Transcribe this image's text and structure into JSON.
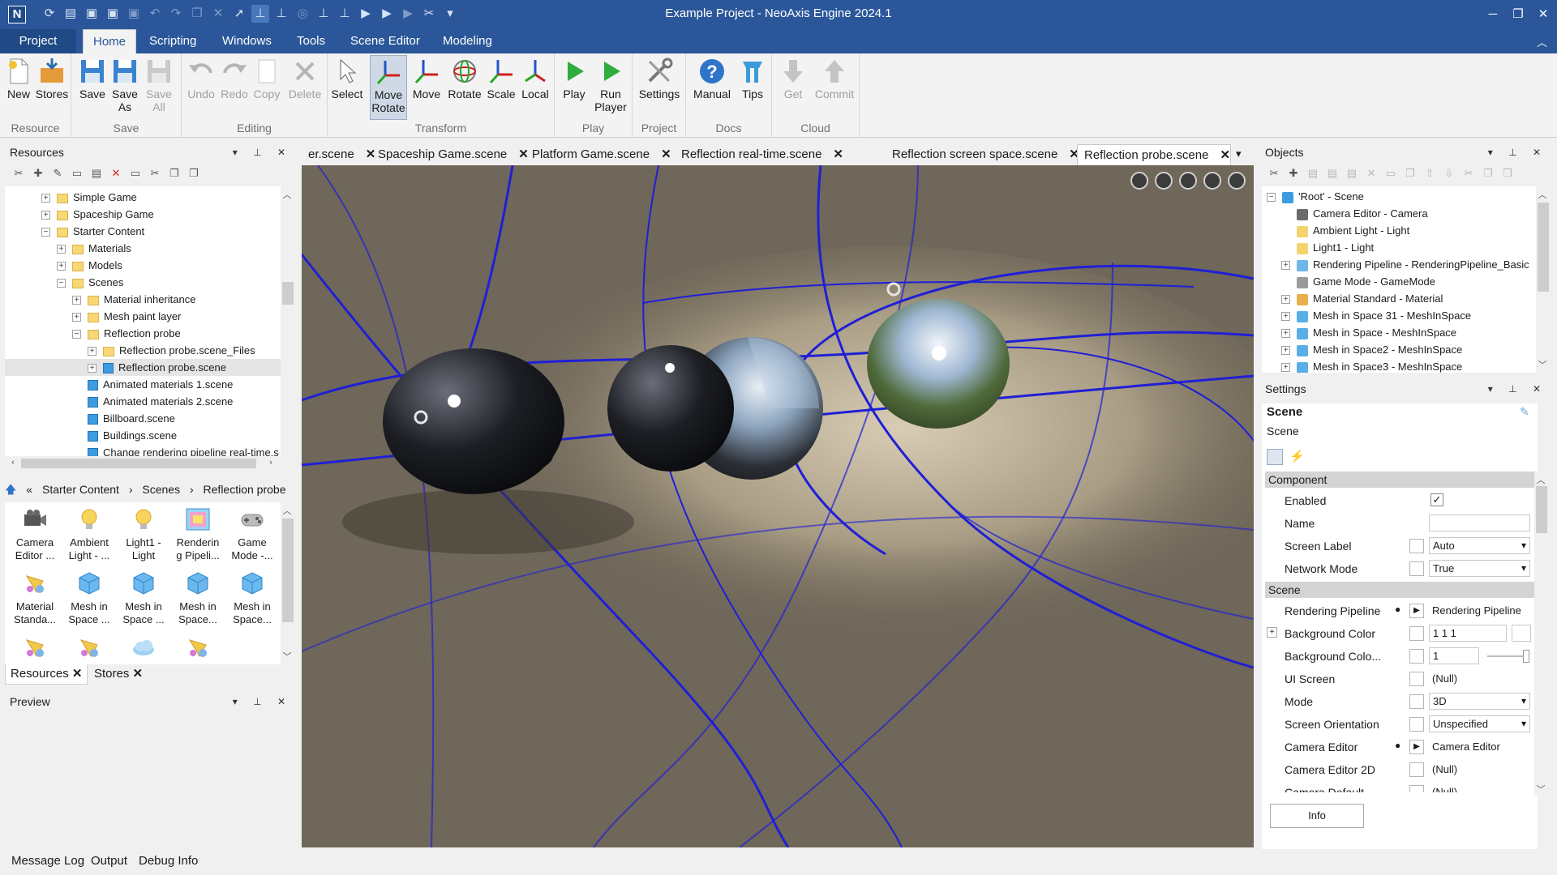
{
  "window": {
    "title": "Example Project - NeoAxis Engine 2024.1",
    "logo": "N"
  },
  "quick_access": [
    "refresh-icon",
    "new-icon",
    "save-icon",
    "save-all-icon",
    "save-as-icon",
    "undo-icon",
    "redo-icon",
    "copy-icon",
    "delete-icon",
    "select-icon",
    "move-rotate-icon",
    "move-icon",
    "rotate-icon",
    "scale-icon",
    "local-icon",
    "play-icon",
    "run-player-icon",
    "settings-icon",
    "dropdown-icon"
  ],
  "ribbon_tabs": [
    "Project",
    "Home",
    "Scripting",
    "Windows",
    "Tools",
    "Scene Editor",
    "Modeling"
  ],
  "ribbon": {
    "groups": {
      "resource": "Resource",
      "save": "Save",
      "editing": "Editing",
      "transform": "Transform",
      "play": "Play",
      "project": "Project",
      "docs": "Docs",
      "cloud": "Cloud"
    },
    "buttons": {
      "new": "New",
      "stores": "Stores",
      "save": "Save",
      "save_as_1": "Save",
      "save_as_2": "As",
      "save_all_1": "Save",
      "save_all_2": "All",
      "undo": "Undo",
      "redo": "Redo",
      "copy": "Copy",
      "delete": "Delete",
      "select": "Select",
      "move_rotate_1": "Move",
      "move_rotate_2": "Rotate",
      "move": "Move",
      "rotate": "Rotate",
      "scale": "Scale",
      "local": "Local",
      "play": "Play",
      "run_player_1": "Run",
      "run_player_2": "Player",
      "settings": "Settings",
      "manual": "Manual",
      "tips": "Tips",
      "get": "Get",
      "commit": "Commit"
    }
  },
  "resources_panel": {
    "title": "Resources",
    "tree": [
      {
        "label": "Simple Game",
        "indent": 0,
        "exp": "+",
        "icon": "folder"
      },
      {
        "label": "Spaceship Game",
        "indent": 0,
        "exp": "+",
        "icon": "folder"
      },
      {
        "label": "Starter Content",
        "indent": 0,
        "exp": "−",
        "icon": "folder"
      },
      {
        "label": "Materials",
        "indent": 1,
        "exp": "+",
        "icon": "folder"
      },
      {
        "label": "Models",
        "indent": 1,
        "exp": "+",
        "icon": "folder"
      },
      {
        "label": "Scenes",
        "indent": 1,
        "exp": "−",
        "icon": "folder"
      },
      {
        "label": "Material inheritance",
        "indent": 2,
        "exp": "+",
        "icon": "folder"
      },
      {
        "label": "Mesh paint layer",
        "indent": 2,
        "exp": "+",
        "icon": "folder"
      },
      {
        "label": "Reflection probe",
        "indent": 2,
        "exp": "−",
        "icon": "folder"
      },
      {
        "label": "Reflection probe.scene_Files",
        "indent": 3,
        "exp": "+",
        "icon": "folder"
      },
      {
        "label": "Reflection probe.scene",
        "indent": 3,
        "exp": "+",
        "icon": "scene"
      },
      {
        "label": "Animated materials 1.scene",
        "indent": 2,
        "exp": "",
        "icon": "scene"
      },
      {
        "label": "Animated materials 2.scene",
        "indent": 2,
        "exp": "",
        "icon": "scene"
      },
      {
        "label": "Billboard.scene",
        "indent": 2,
        "exp": "",
        "icon": "scene"
      },
      {
        "label": "Buildings.scene",
        "indent": 2,
        "exp": "",
        "icon": "scene"
      },
      {
        "label": "Change rendering pipeline real-time.s",
        "indent": 2,
        "exp": "",
        "icon": "scene"
      }
    ],
    "breadcrumb": [
      "«",
      "Starter Content",
      "›",
      "Scenes",
      "›",
      "Reflection probe",
      "›"
    ],
    "grid": [
      {
        "l1": "Camera",
        "l2": "Editor ...",
        "icon": "camera-icon"
      },
      {
        "l1": "Ambient",
        "l2": "Light - ...",
        "icon": "light-bulb-icon"
      },
      {
        "l1": "Light1 -",
        "l2": "Light",
        "icon": "light-bulb-icon"
      },
      {
        "l1": "Renderin",
        "l2": "g Pipeli...",
        "icon": "pipeline-icon"
      },
      {
        "l1": "Game",
        "l2": "Mode -...",
        "icon": "gamepad-icon"
      },
      {
        "l1": "Material",
        "l2": "Standa...",
        "icon": "material-icon"
      },
      {
        "l1": "Mesh in",
        "l2": "Space ...",
        "icon": "mesh-icon"
      },
      {
        "l1": "Mesh in",
        "l2": "Space ...",
        "icon": "mesh-icon"
      },
      {
        "l1": "Mesh in",
        "l2": "Space...",
        "icon": "mesh-icon"
      },
      {
        "l1": "Mesh in",
        "l2": "Space...",
        "icon": "mesh-icon"
      },
      {
        "l1": "",
        "l2": "",
        "icon": "material-icon"
      },
      {
        "l1": "",
        "l2": "",
        "icon": "material-icon"
      },
      {
        "l1": "",
        "l2": "",
        "icon": "sky-icon"
      },
      {
        "l1": "",
        "l2": "",
        "icon": "material-icon"
      }
    ],
    "tabs": [
      "Resources",
      "Stores"
    ]
  },
  "preview_panel": {
    "title": "Preview"
  },
  "doc_tabs": [
    "er.scene",
    "Spaceship Game.scene",
    "Platform Game.scene",
    "Reflection real-time.scene",
    "Reflection screen space.scene",
    "Reflection probe.scene"
  ],
  "objects_panel": {
    "title": "Objects",
    "items": [
      {
        "label": "'Root' - Scene",
        "indent": 0,
        "exp": "−",
        "color": "#3d9be0"
      },
      {
        "label": "Camera Editor - Camera",
        "indent": 1,
        "exp": "",
        "color": "#6b6b6b"
      },
      {
        "label": "Ambient Light - Light",
        "indent": 1,
        "exp": "",
        "color": "#f3d36b"
      },
      {
        "label": "Light1 - Light",
        "indent": 1,
        "exp": "",
        "color": "#f3d36b"
      },
      {
        "label": "Rendering Pipeline - RenderingPipeline_Basic",
        "indent": 1,
        "exp": "+",
        "color": "#6fb7e8"
      },
      {
        "label": "Game Mode - GameMode",
        "indent": 1,
        "exp": "",
        "color": "#9a9a9a"
      },
      {
        "label": "Material Standard - Material",
        "indent": 1,
        "exp": "+",
        "color": "#e8b04a"
      },
      {
        "label": "Mesh in Space 31 - MeshInSpace",
        "indent": 1,
        "exp": "+",
        "color": "#5aaee6"
      },
      {
        "label": "Mesh in Space - MeshInSpace",
        "indent": 1,
        "exp": "+",
        "color": "#5aaee6"
      },
      {
        "label": "Mesh in Space2 - MeshInSpace",
        "indent": 1,
        "exp": "+",
        "color": "#5aaee6"
      },
      {
        "label": "Mesh in Space3 - MeshInSpace",
        "indent": 1,
        "exp": "+",
        "color": "#5aaee6"
      }
    ]
  },
  "settings_panel": {
    "title": "Settings",
    "object_name": "Scene",
    "object_type": "Scene",
    "categories": {
      "component": "Component",
      "scene": "Scene"
    },
    "rows": {
      "enabled": "Enabled",
      "name": "Name",
      "screen_label": {
        "label": "Screen Label",
        "value": "Auto"
      },
      "network_mode": {
        "label": "Network Mode",
        "value": "True"
      },
      "rendering_pipeline": {
        "label": "Rendering Pipeline",
        "value": "Rendering Pipeline"
      },
      "background_color": {
        "label": "Background Color",
        "value": "1 1 1"
      },
      "background_color_mult": {
        "label": "Background Colo...",
        "value": "1"
      },
      "ui_screen": {
        "label": "UI Screen",
        "value": "(Null)"
      },
      "mode": {
        "label": "Mode",
        "value": "3D"
      },
      "screen_orientation": {
        "label": "Screen Orientation",
        "value": "Unspecified"
      },
      "camera_editor": {
        "label": "Camera Editor",
        "value": "Camera Editor"
      },
      "camera_editor_2d": {
        "label": "Camera Editor 2D",
        "value": "(Null)"
      },
      "camera_default": {
        "label": "Camera Default",
        "value": "(Null)"
      }
    },
    "info_button": "Info"
  },
  "status_tabs": [
    "Message Log",
    "Output",
    "Debug Info"
  ],
  "colors": {
    "accent": "#2b579a",
    "grid_line": "#1f1fd6",
    "floor": "#6f6759"
  }
}
